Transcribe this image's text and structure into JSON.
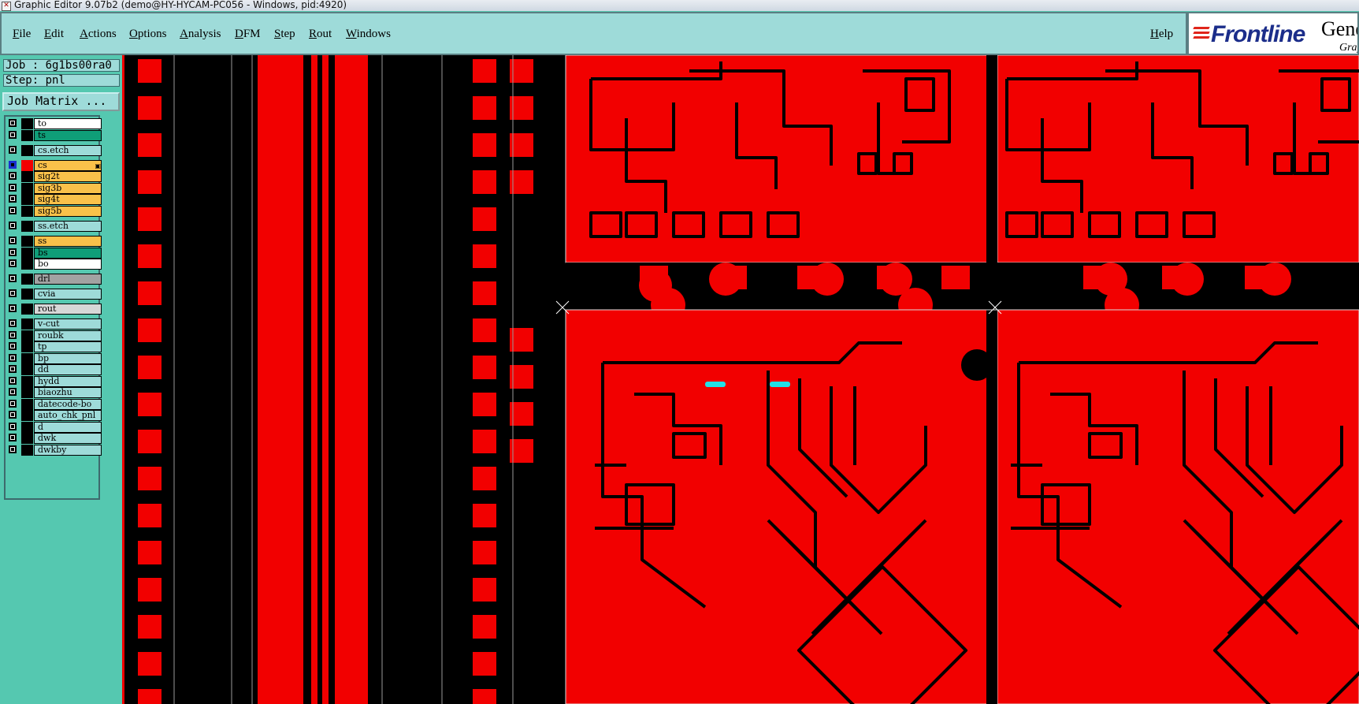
{
  "window": {
    "title": "Graphic Editor 9.07b2 (demo@HY-HYCAM-PC056 - Windows, pid:4920)"
  },
  "menubar": {
    "items": [
      "File",
      "Edit",
      "Actions",
      "Options",
      "Analysis",
      "DFM",
      "Step",
      "Rout",
      "Windows"
    ],
    "help": "Help"
  },
  "brand": {
    "logo": "Frontline",
    "product": "Gene",
    "subtitle": "Grap"
  },
  "panel": {
    "job": "Job : 6g1bs00ra0",
    "step": "Step: pnl",
    "job_matrix_button": "Job Matrix ..."
  },
  "layers": [
    {
      "name": "to",
      "color": "#ffffff"
    },
    {
      "name": "ts",
      "color": "#0f9e78"
    },
    {
      "name": "cs.etch",
      "color": "#9edbd9"
    },
    {
      "name": "cs",
      "color": "#f9c14a",
      "active": true
    },
    {
      "name": "sig2t",
      "color": "#f9c14a"
    },
    {
      "name": "sig3b",
      "color": "#f9c14a"
    },
    {
      "name": "sig4t",
      "color": "#f9c14a"
    },
    {
      "name": "sig5b",
      "color": "#f9c14a"
    },
    {
      "name": "ss.etch",
      "color": "#9edbd9"
    },
    {
      "name": "ss",
      "color": "#f9c14a"
    },
    {
      "name": "bs",
      "color": "#0f9e78"
    },
    {
      "name": "bo",
      "color": "#ffffff"
    },
    {
      "name": "drl",
      "color": "#a2a2a2"
    },
    {
      "name": "cvia",
      "color": "#9edbd9"
    },
    {
      "name": "rout",
      "color": "#d7d7d7"
    },
    {
      "name": "v-cut",
      "color": "#9edbd9"
    },
    {
      "name": "roubk",
      "color": "#9edbd9"
    },
    {
      "name": "tp",
      "color": "#9edbd9"
    },
    {
      "name": "bp",
      "color": "#9edbd9"
    },
    {
      "name": "dd",
      "color": "#9edbd9"
    },
    {
      "name": "hydd",
      "color": "#9edbd9"
    },
    {
      "name": "biaozhu",
      "color": "#9edbd9"
    },
    {
      "name": "datecode-bo",
      "color": "#9edbd9"
    },
    {
      "name": "auto_chk_pnl",
      "color": "#9edbd9"
    },
    {
      "name": "d",
      "color": "#9edbd9"
    },
    {
      "name": "dwk",
      "color": "#9edbd9"
    },
    {
      "name": "dwkby",
      "color": "#9edbd9"
    }
  ],
  "colors": {
    "copper": "#f20000",
    "background": "#000000",
    "panel": "#55c8b0",
    "menubar": "#9edbd9",
    "highlight": "#22e0e8"
  }
}
